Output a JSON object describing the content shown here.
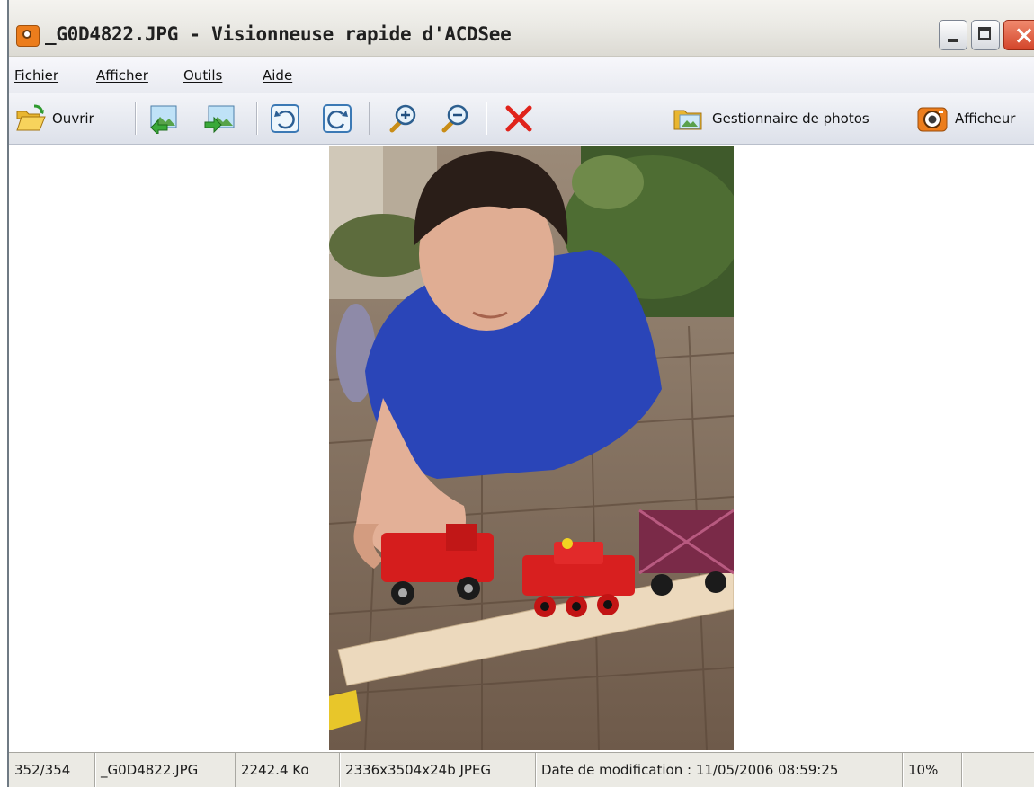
{
  "window": {
    "title": "_G0D4822.JPG - Visionneuse rapide d'ACDSee"
  },
  "menu": [
    "Fichier",
    "Afficher",
    "Outils",
    "Aide"
  ],
  "toolbar": {
    "open_label": "Ouvrir",
    "photo_manager_label": "Gestionnaire de photos",
    "viewer_label": "Afficheur"
  },
  "status": {
    "position": "352/354",
    "filename": "_G0D4822.JPG",
    "filesize": "2242.4 Ko",
    "dimensions": "2336x3504x24b JPEG",
    "modified": "Date de modification : 11/05/2006 08:59:25",
    "zoom": "10%"
  },
  "colors": {
    "accent_icon": "#ec7d1c",
    "delete_icon": "#e0231b",
    "close_button": "#d3452a"
  }
}
